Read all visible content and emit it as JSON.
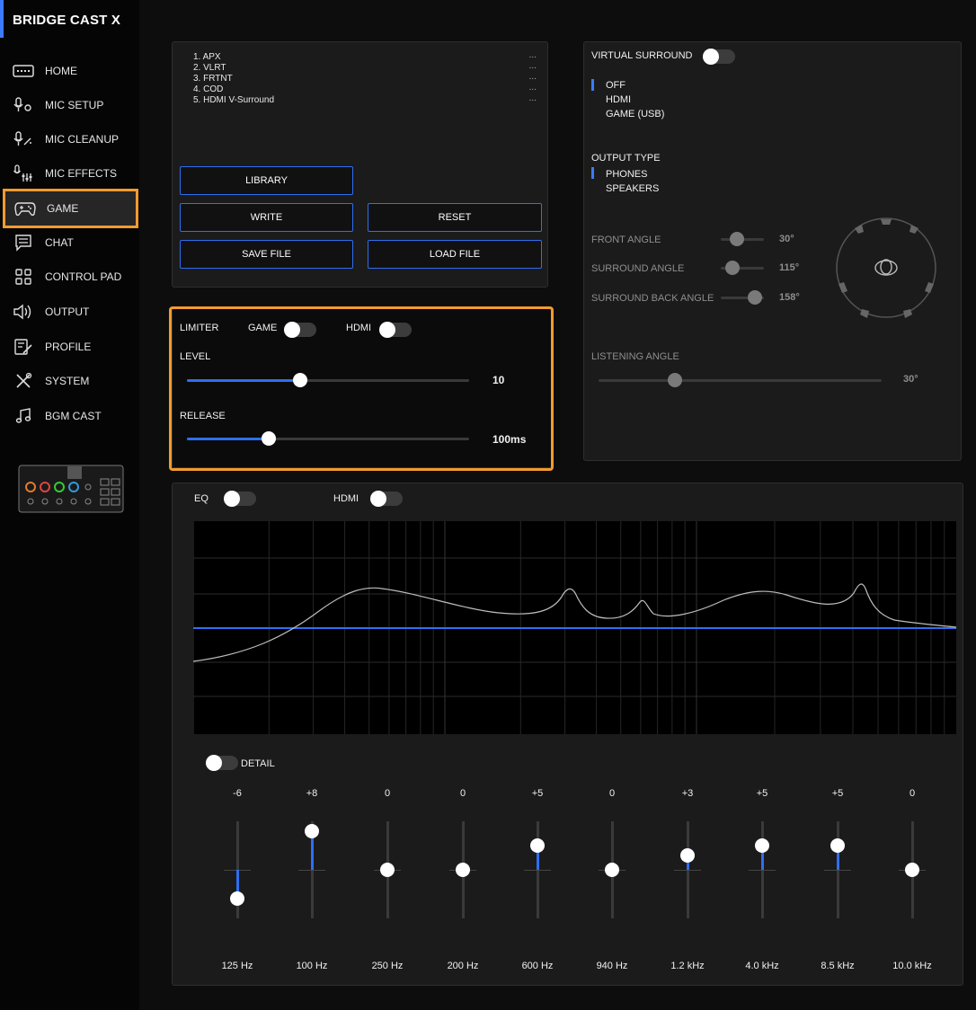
{
  "app": {
    "title": "BRIDGE CAST X"
  },
  "sidebar": {
    "items": [
      {
        "label": "HOME",
        "icon": "keyboard-icon"
      },
      {
        "label": "MIC SETUP",
        "icon": "mic-gear-icon"
      },
      {
        "label": "MIC CLEANUP",
        "icon": "mic-sparkle-icon"
      },
      {
        "label": "MIC EFFECTS",
        "icon": "mic-mixer-icon"
      },
      {
        "label": "GAME",
        "icon": "gamepad-icon",
        "active": true
      },
      {
        "label": "CHAT",
        "icon": "chat-icon"
      },
      {
        "label": "CONTROL PAD",
        "icon": "grid-icon"
      },
      {
        "label": "OUTPUT",
        "icon": "speaker-icon"
      },
      {
        "label": "PROFILE",
        "icon": "profile-edit-icon"
      },
      {
        "label": "SYSTEM",
        "icon": "tools-icon"
      },
      {
        "label": "BGM CAST",
        "icon": "music-note-icon"
      }
    ]
  },
  "presets": {
    "items": [
      {
        "label": "1. APX",
        "more": "..."
      },
      {
        "label": "2. VLRT",
        "more": "..."
      },
      {
        "label": "3. FRTNT",
        "more": "..."
      },
      {
        "label": "4. COD",
        "more": "..."
      },
      {
        "label": "5. HDMI V-Surround",
        "more": "..."
      }
    ],
    "buttons": {
      "library": "LIBRARY",
      "write": "WRITE",
      "reset": "RESET",
      "save_file": "SAVE FILE",
      "load_file": "LOAD FILE"
    }
  },
  "limiter": {
    "label": "LIMITER",
    "game_label": "GAME",
    "hdmi_label": "HDMI",
    "level_label": "LEVEL",
    "level_value": "10",
    "level_fraction": 0.4,
    "release_label": "RELEASE",
    "release_value": "100ms",
    "release_fraction": 0.29
  },
  "surround": {
    "title": "VIRTUAL SURROUND",
    "modes": [
      "OFF",
      "HDMI",
      "GAME (USB)"
    ],
    "selected_mode": "OFF",
    "output_type_label": "OUTPUT TYPE",
    "output_types": [
      "PHONES",
      "SPEAKERS"
    ],
    "selected_output": "PHONES",
    "front_angle_label": "FRONT ANGLE",
    "front_angle_value": "30°",
    "surround_angle_label": "SURROUND ANGLE",
    "surround_angle_value": "115°",
    "surround_back_angle_label": "SURROUND BACK ANGLE",
    "surround_back_angle_value": "158°",
    "listening_angle_label": "LISTENING ANGLE",
    "listening_angle_value": "30°"
  },
  "eq": {
    "label": "EQ",
    "hdmi_label": "HDMI",
    "detail_label": "DETAIL",
    "bands": [
      {
        "gain": "-6",
        "freq": "125 Hz",
        "value": -6
      },
      {
        "gain": "+8",
        "freq": "100 Hz",
        "value": 8
      },
      {
        "gain": "0",
        "freq": "250 Hz",
        "value": 0
      },
      {
        "gain": "0",
        "freq": "200 Hz",
        "value": 0
      },
      {
        "gain": "+5",
        "freq": "600 Hz",
        "value": 5
      },
      {
        "gain": "0",
        "freq": "940 Hz",
        "value": 0
      },
      {
        "gain": "+3",
        "freq": "1.2 kHz",
        "value": 3
      },
      {
        "gain": "+5",
        "freq": "4.0 kHz",
        "value": 5
      },
      {
        "gain": "+5",
        "freq": "8.5 kHz",
        "value": 5
      },
      {
        "gain": "0",
        "freq": "10.0 kHz",
        "value": 0
      }
    ]
  },
  "colors": {
    "accent": "#2f6ef0",
    "highlight": "#f29b2f"
  }
}
